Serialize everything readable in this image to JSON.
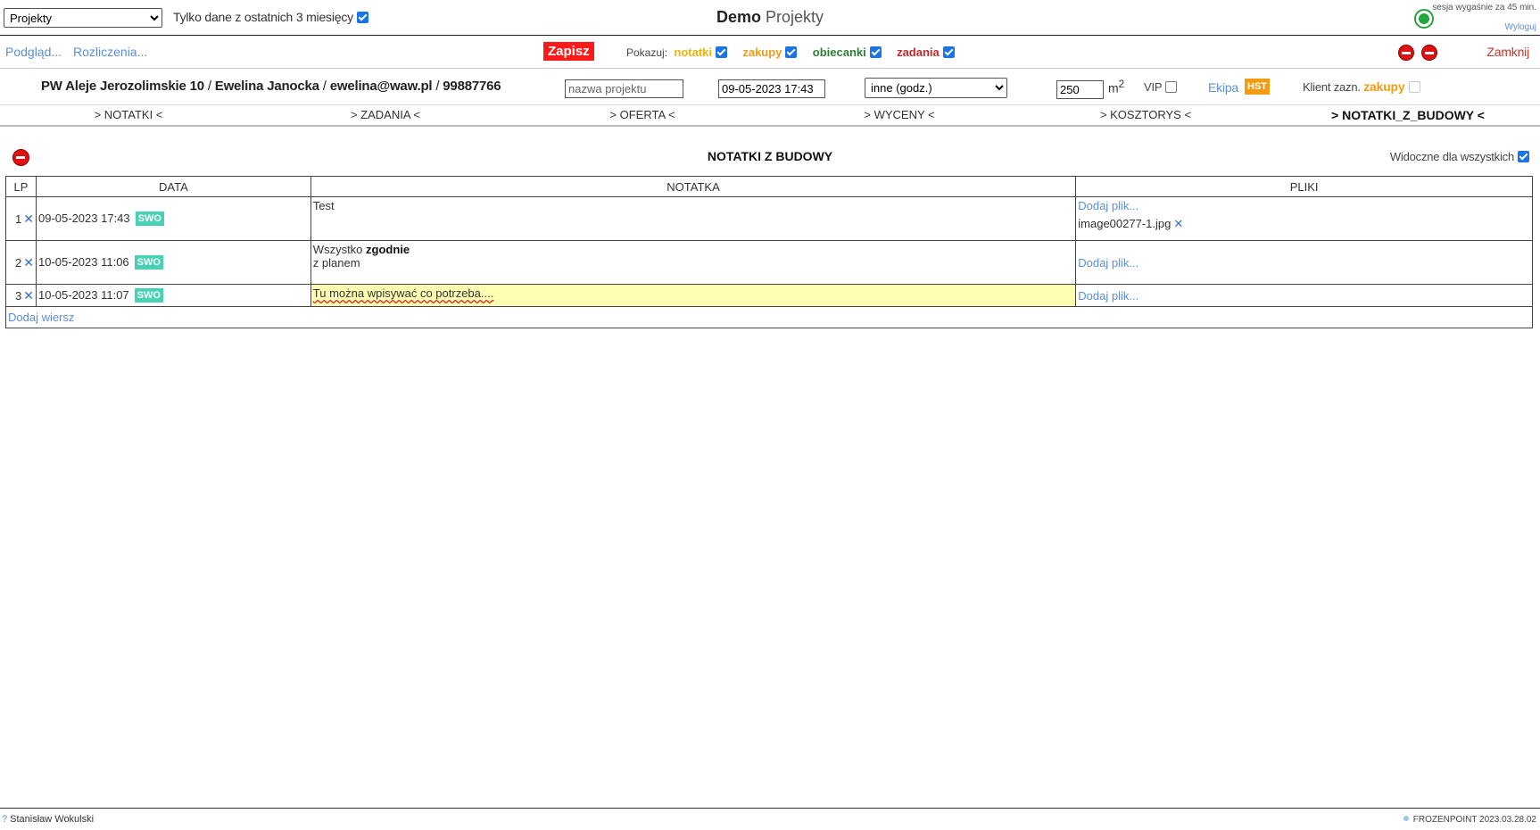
{
  "top": {
    "module_select": "Projekty",
    "last3_label": "Tylko dane z ostatnich 3 miesięcy",
    "title_bold": "Demo",
    "title_normal": "Projekty",
    "session_text": "sesja wygaśnie za 45 min.",
    "logout_label": "Wyloguj",
    "status_color": "#22a83a"
  },
  "toolbar": {
    "preview_label": "Podgląd...",
    "settlements_label": "Rozliczenia...",
    "save_label": "Zapisz",
    "show_label": "Pokazuj:",
    "filters": [
      {
        "label": "notatki",
        "color": "#f0b400",
        "checked": true
      },
      {
        "label": "zakupy",
        "color": "#f39c12",
        "checked": true
      },
      {
        "label": "obiecanki",
        "color": "#2e7d32",
        "checked": true
      },
      {
        "label": "zadania",
        "color": "#c62828",
        "checked": true
      }
    ],
    "close_label": "Zamknij"
  },
  "project": {
    "address": "PW Aleje Jerozolimskie 10",
    "person": "Ewelina Janocka",
    "email": "ewelina@waw.pl",
    "phone": "99887766",
    "name_placeholder": "nazwa projektu",
    "date_value": "09-05-2023 17:43",
    "type_select": "inne (godz.)",
    "area_value": "250",
    "area_unit": "m",
    "area_sup": "2",
    "vip_label": "VIP",
    "team_label": "Ekipa",
    "team_badge": "HST",
    "client_marked_label": "Klient zazn.",
    "client_marked_value": "zakupy"
  },
  "tabs": [
    {
      "label": "> NOTATKI <",
      "active": false
    },
    {
      "label": "> ZADANIA <",
      "active": false
    },
    {
      "label": "> OFERTA <",
      "active": false
    },
    {
      "label": "> WYCENY <",
      "active": false
    },
    {
      "label": "> KOSZTORYS <",
      "active": false
    },
    {
      "label": "> NOTATKI_Z_BUDOWY <",
      "active": true
    }
  ],
  "section": {
    "title": "NOTATKI Z BUDOWY",
    "visible_all_label": "Widoczne dla wszystkich"
  },
  "table": {
    "headers": [
      "LP",
      "DATA",
      "NOTATKA",
      "PLIKI"
    ],
    "rows": [
      {
        "lp": "1",
        "date": "09-05-2023 17:43",
        "badge": "SWO",
        "note_line1": "Test",
        "note_bold": "",
        "note_line2": "",
        "add_file": "Dodaj plik...",
        "file": "image00277-1.jpg"
      },
      {
        "lp": "2",
        "date": "10-05-2023 11:06",
        "badge": "SWO",
        "note_line1": "Wszystko",
        "note_bold": "zgodnie",
        "note_line2": "z planem",
        "add_file": "Dodaj plik...",
        "file": ""
      },
      {
        "lp": "3",
        "date": "10-05-2023 11:07",
        "badge": "SWO",
        "note_line1": "Tu można wpisywać co potrzeba....",
        "note_bold": "",
        "note_line2": "",
        "add_file": "Dodaj plik...",
        "file": ""
      }
    ],
    "add_row_label": "Dodaj wiersz"
  },
  "footer": {
    "user_icon": "?",
    "user": "Stanisław Wokulski",
    "version": "FROZENPOINT 2023.03.28.02"
  }
}
